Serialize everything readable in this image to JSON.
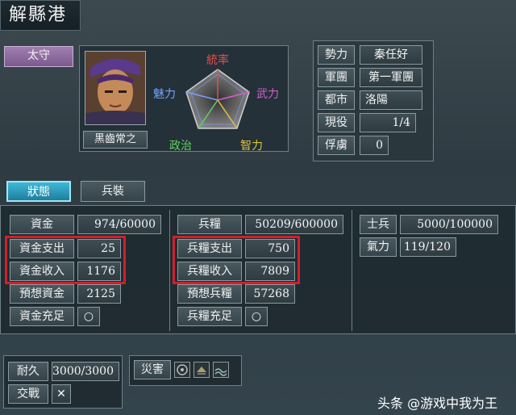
{
  "city_name": "解縣港",
  "governor": {
    "title": "太守",
    "name": "黑齒常之"
  },
  "radar": {
    "labels": {
      "top": "統率",
      "right": "武力",
      "left": "魅力",
      "bottom_right": "智力",
      "bottom_left": "政治"
    },
    "colors": {
      "top": "#e05050",
      "right": "#d060d0",
      "left": "#7aa0ff",
      "bottom_right": "#e0c040",
      "bottom_left": "#60d060"
    }
  },
  "info": [
    {
      "label": "勢力",
      "value": "秦任好"
    },
    {
      "label": "軍團",
      "value": "第一軍團"
    },
    {
      "label": "都市",
      "value": "洛陽"
    },
    {
      "label": "現役",
      "value": "1/4"
    },
    {
      "label": "俘虜",
      "value": "0"
    }
  ],
  "tabs": [
    {
      "label": "狀態",
      "active": true
    },
    {
      "label": "兵裝",
      "active": false
    }
  ],
  "funds": [
    {
      "label": "資金",
      "value": "974/60000"
    },
    {
      "label": "資金支出",
      "value": "25"
    },
    {
      "label": "資金收入",
      "value": "1176"
    },
    {
      "label": "預想資金",
      "value": "2125"
    },
    {
      "label": "資金充足",
      "value": "○"
    }
  ],
  "food": [
    {
      "label": "兵糧",
      "value": "50209/600000"
    },
    {
      "label": "兵糧支出",
      "value": "750"
    },
    {
      "label": "兵糧收入",
      "value": "7809"
    },
    {
      "label": "預想兵糧",
      "value": "57268"
    },
    {
      "label": "兵糧充足",
      "value": "○"
    }
  ],
  "troops": [
    {
      "label": "士兵",
      "value": "5000/100000"
    },
    {
      "label": "氣力",
      "value": "119/120"
    }
  ],
  "durability": {
    "label": "耐久",
    "value": "3000/3000"
  },
  "combat": {
    "label": "交戰",
    "value": "✕"
  },
  "disaster": {
    "label": "災害"
  },
  "watermark": "头条 @游戏中我为王",
  "highlight_color": "#d0202a"
}
